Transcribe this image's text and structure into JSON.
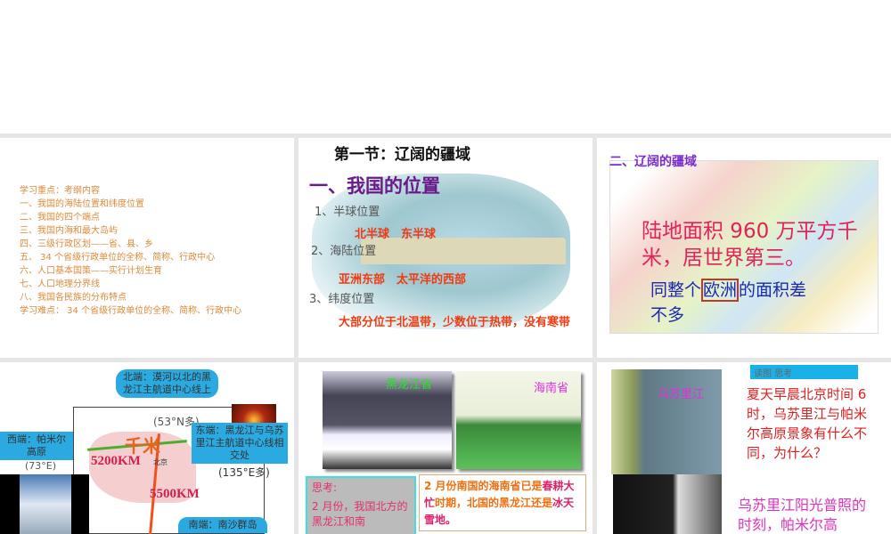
{
  "slide1": {
    "lines": [
      "学习重点：考纲内容",
      "一、我国的海陆位置和纬度位置",
      "二、我国的四个端点",
      "三、我国内海和最大岛屿",
      "四、三级行政区划——省、县、乡",
      "五、 34 个省级行政单位的全称、简称、行政中心",
      "六、人口基本国策——实行计划生育",
      "七、人口地理分界线",
      "八、我国各民族的分布特点",
      "学习难点： 34 个省级行政单位的全称、简称、行政中心"
    ]
  },
  "slide2": {
    "section": "第一节：辽阔的疆域",
    "heading": "一、我国的位置",
    "item1": "1、半球位置",
    "ans1": "北半球　东半球",
    "item2": "2、海陆位置",
    "ans2": "亚洲东部　太平洋的西部",
    "item3": "3、纬度位置",
    "ans3": "大部分位于北温带，少数位于热带，没有寒带"
  },
  "slide3": {
    "heading": "二、辽阔的疆域",
    "main": "陆地面积 960 万平方千米，居世界第三。",
    "sub_pre": "同整个",
    "sub_box": "欧洲",
    "sub_post": "的面积差不多"
  },
  "slide4": {
    "north": "北端：漠河以北的黑龙江主航道中心线上",
    "north_lat": "(53°N多)",
    "west": "西端：帕米尔高原",
    "west_lon": "(73°E)",
    "east": "东端：黑龙江与乌苏里江主航道中心线相交处",
    "east_lon": "(135°E多)",
    "south": "南端：南沙群岛",
    "ew_dist": "5200KM",
    "ns_dist": "5500KM",
    "ew_label": "千米",
    "beijing": "北京"
  },
  "slide5": {
    "photo1_label": "黑龙江省",
    "photo2_label": "海南省",
    "think_title": "思考:",
    "think_text": "2 月份，我国北方的黑龙江和南",
    "answer_1": "2 月份南国的海南省已是",
    "answer_2": "春耕大忙",
    "answer_3": "时期，北国的",
    "answer_4": "黑龙江还是",
    "answer_5": "冰天雪地。"
  },
  "slide6": {
    "photo_label": "乌苏里江",
    "tag": "读图 思考",
    "question": "夏天早晨北京时间 6 时，乌苏里江与帕米尔高原景象有什么不同，为什么？",
    "answer": "乌苏里江阳光普照的时刻，帕米尔高"
  }
}
